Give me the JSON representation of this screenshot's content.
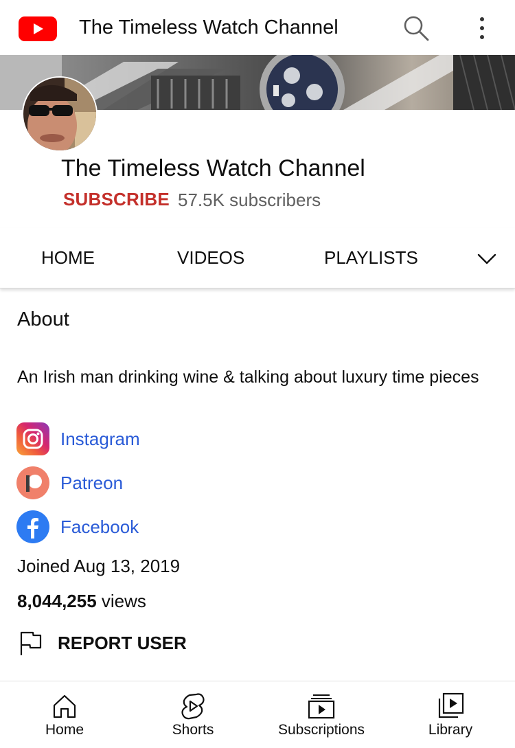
{
  "header": {
    "title": "The Timeless Watch Channel",
    "logo_icon": "youtube-logo-icon",
    "search_icon": "search-icon",
    "more_icon": "more-vertical-icon",
    "brand_color": "#ff0000"
  },
  "channel": {
    "name": "The Timeless Watch Channel",
    "subscribe_label": "SUBSCRIBE",
    "subscribers": "57.5K subscribers",
    "subscribe_color": "#c4302b"
  },
  "tabs": [
    {
      "label": "HOME"
    },
    {
      "label": "VIDEOS"
    },
    {
      "label": "PLAYLISTS"
    }
  ],
  "tabs_more_icon": "chevron-down-icon",
  "about": {
    "heading": "About",
    "description": "An Irish man drinking wine & talking about luxury time pieces",
    "links": [
      {
        "label": "Instagram",
        "icon": "instagram-icon"
      },
      {
        "label": "Patreon",
        "icon": "patreon-icon"
      },
      {
        "label": "Facebook",
        "icon": "facebook-icon"
      }
    ],
    "link_color": "#2a5bd7",
    "joined": "Joined Aug 13, 2019",
    "views_count": "8,044,255",
    "views_suffix": " views",
    "report_label": "REPORT USER",
    "report_icon": "flag-icon"
  },
  "bottom_nav": [
    {
      "label": "Home",
      "icon": "home-icon"
    },
    {
      "label": "Shorts",
      "icon": "shorts-icon"
    },
    {
      "label": "Subscriptions",
      "icon": "subscriptions-icon"
    },
    {
      "label": "Library",
      "icon": "library-icon"
    }
  ]
}
